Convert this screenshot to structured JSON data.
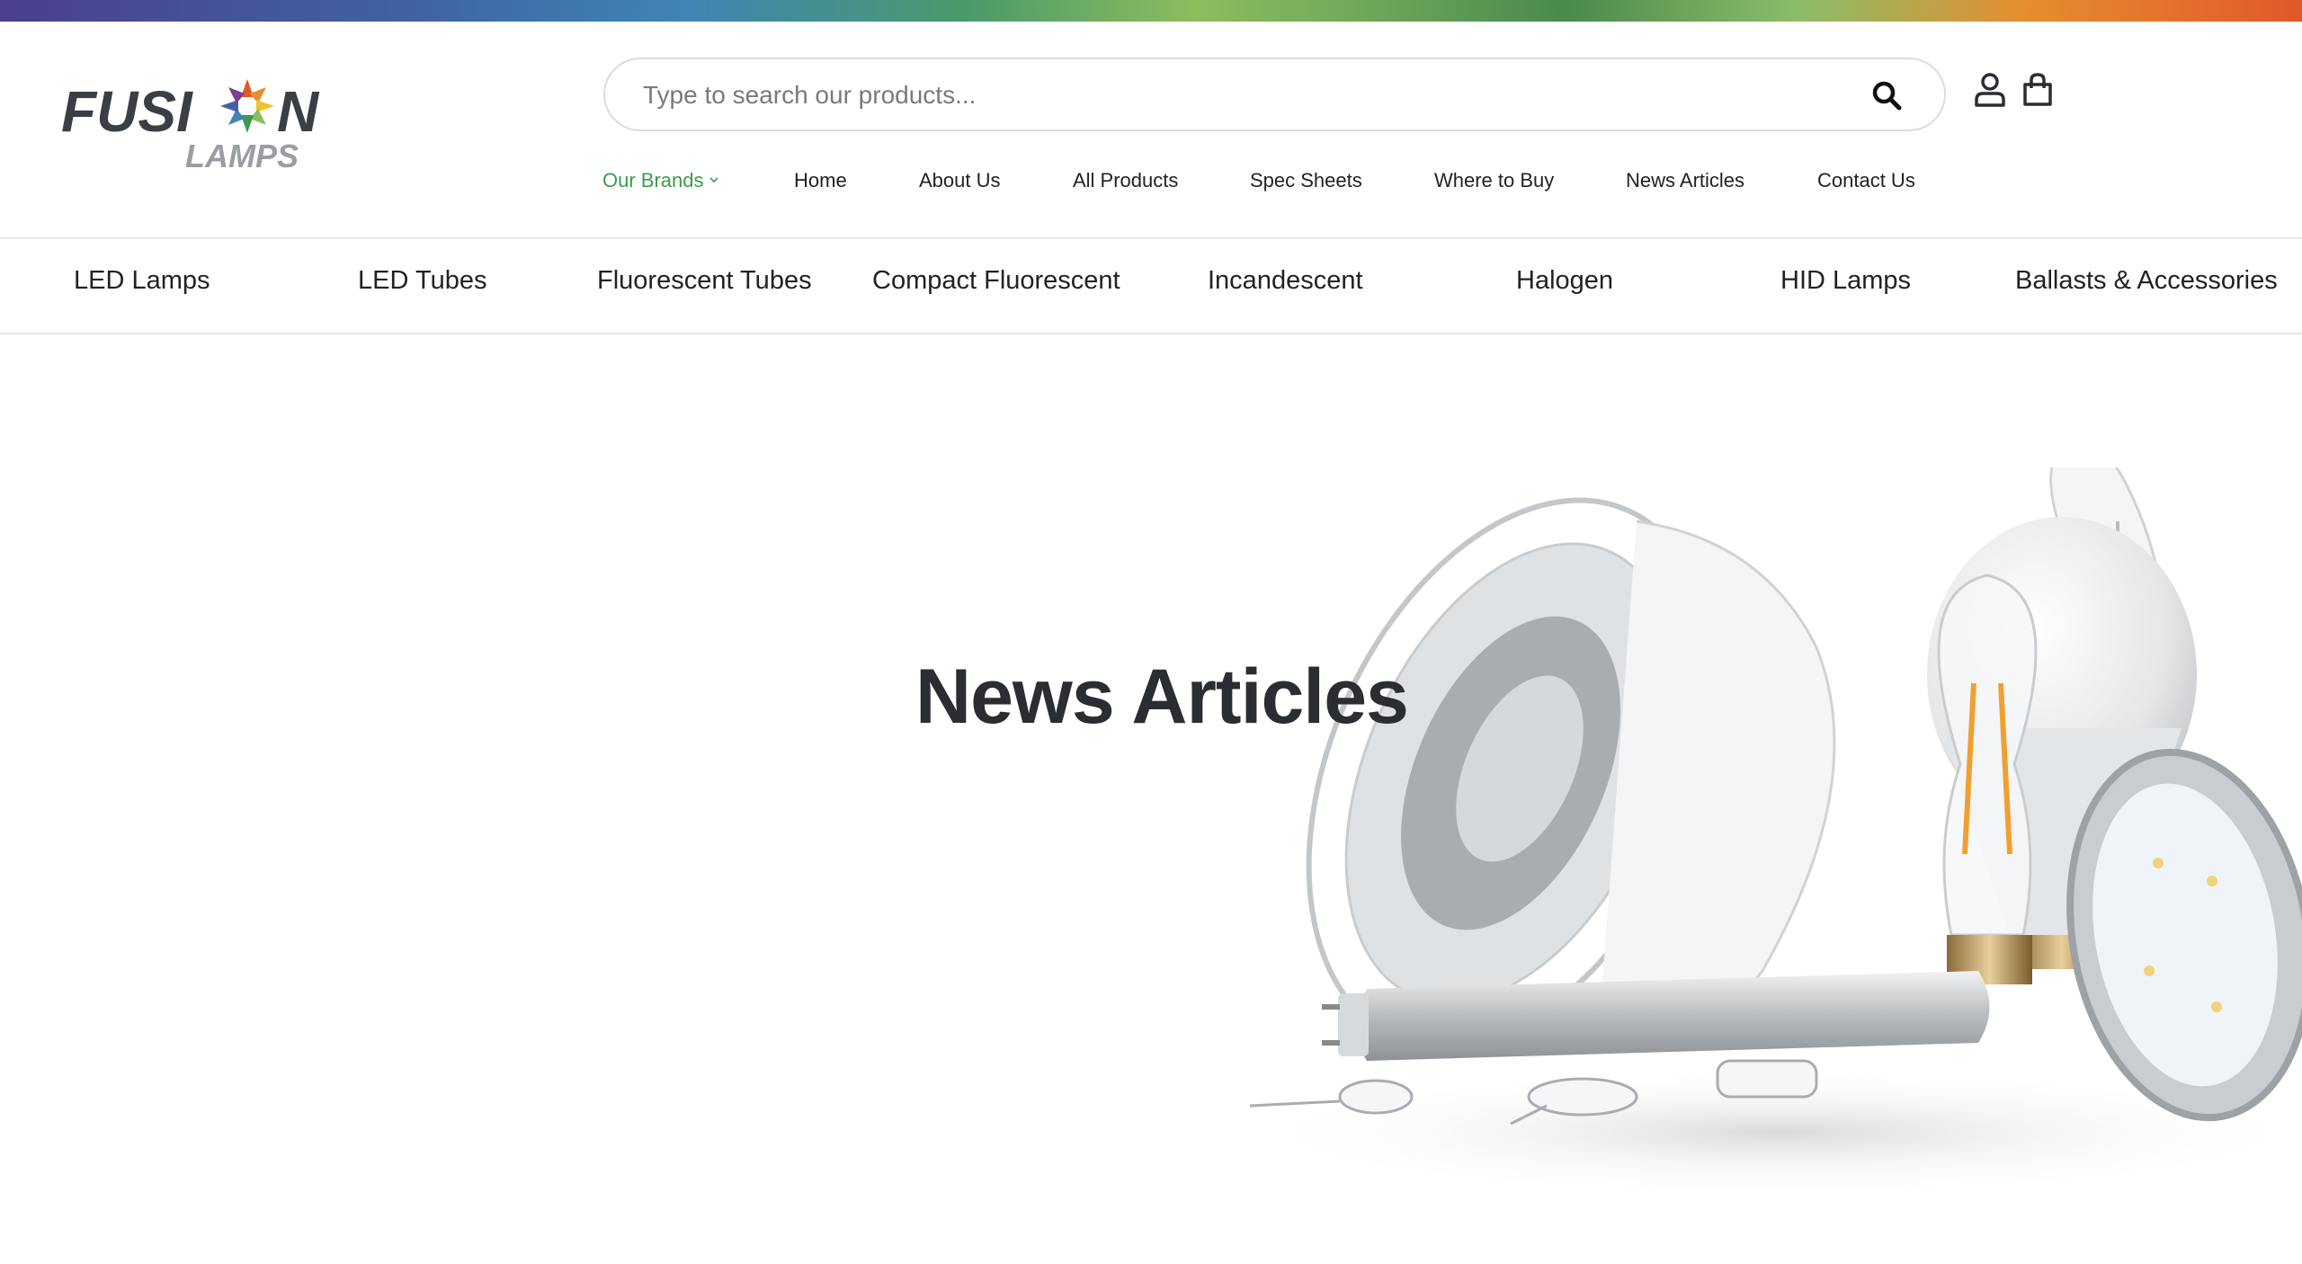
{
  "brand": {
    "line1": "FUSI",
    "line1b": "N",
    "line2": "LAMPS"
  },
  "search": {
    "placeholder": "Type to search our products..."
  },
  "nav": {
    "brands": "Our Brands",
    "items": [
      "Home",
      "About Us",
      "All Products",
      "Spec Sheets",
      "Where to Buy",
      "News Articles",
      "Contact Us"
    ]
  },
  "categories": [
    "LED Lamps",
    "LED Tubes",
    "Fluorescent Tubes",
    "Compact Fluorescent",
    "Incandescent",
    "Halogen",
    "HID Lamps",
    "Ballasts & Accessories"
  ],
  "hero": {
    "title": "News Articles"
  },
  "colors": {
    "accent_green": "#3c9b4c",
    "text_dark": "#2a2d32",
    "logo_dark": "#3a3f46",
    "logo_gray": "#9a9ea4"
  },
  "icons": {
    "search": "search-icon",
    "account": "account-icon",
    "cart": "shopping-bag-icon"
  }
}
